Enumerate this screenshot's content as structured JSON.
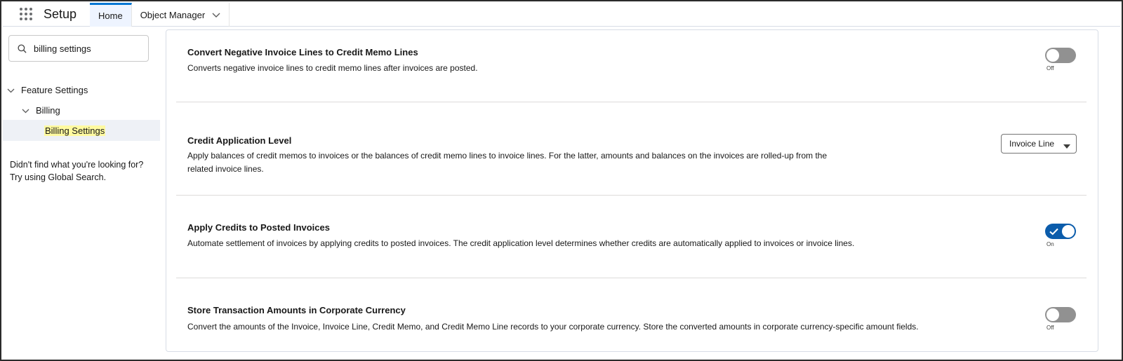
{
  "header": {
    "app_name": "Setup",
    "tabs": [
      {
        "label": "Home",
        "active": true
      },
      {
        "label": "Object Manager",
        "active": false
      }
    ]
  },
  "sidebar": {
    "search": {
      "value": "billing settings",
      "icon": "search-icon"
    },
    "tree": [
      {
        "label": "Feature Settings",
        "expanded": true,
        "level": 0
      },
      {
        "label": "Billing",
        "expanded": true,
        "level": 1
      },
      {
        "label": "Billing Settings",
        "level": 2,
        "selected": true
      }
    ],
    "not_found_line1": "Didn't find what you're looking for?",
    "not_found_line2": "Try using Global Search."
  },
  "settings": [
    {
      "title": "Convert Negative Invoice Lines to Credit Memo Lines",
      "description": "Converts negative invoice lines to credit memo lines after invoices are posted.",
      "control": "toggle",
      "state": "off",
      "state_label": "Off"
    },
    {
      "title": "Credit Application Level",
      "description_line1": "Apply balances of credit memos to invoices or the balances of credit memo lines to invoice lines. For the latter, amounts and balances on the invoices are rolled-up from the",
      "description_line2": "related invoice lines.",
      "control": "select",
      "selected_value": "Invoice Line"
    },
    {
      "title": "Apply Credits to Posted Invoices",
      "description": "Automate settlement of invoices by applying credits to posted invoices. The credit application level determines whether credits are automatically applied to invoices or invoice lines.",
      "control": "toggle",
      "state": "on",
      "state_label": "On"
    },
    {
      "title": "Store Transaction Amounts in Corporate Currency",
      "description": "Convert the amounts of the Invoice, Invoice Line, Credit Memo, and Credit Memo Line records to your corporate currency. Store the converted amounts in corporate currency-specific amount fields.",
      "control": "toggle",
      "state": "off",
      "state_label": "Off"
    }
  ],
  "colors": {
    "accent": "#0176d3",
    "toggle_on": "#0b5cab",
    "toggle_off": "#919191",
    "search_highlight": "#fffaa0",
    "selected_row": "#eef1f6"
  }
}
